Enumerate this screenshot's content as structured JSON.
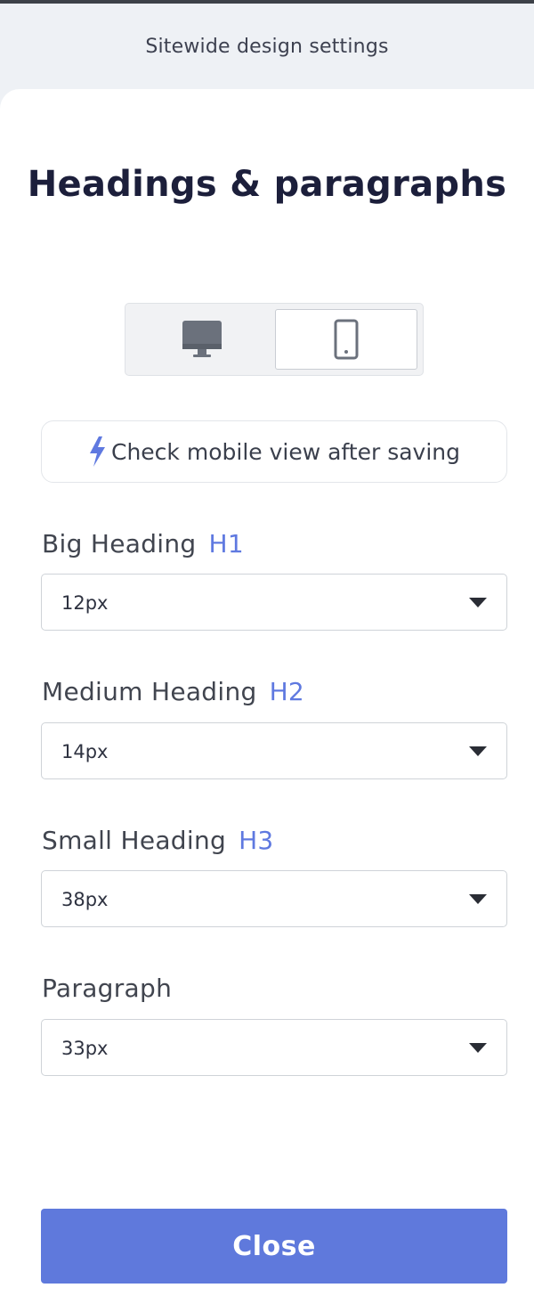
{
  "header": {
    "title": "Sitewide design settings"
  },
  "panel": {
    "title": "Headings & paragraphs",
    "device_toggle": {
      "options": [
        "desktop",
        "mobile"
      ],
      "selected": "mobile"
    },
    "notice": {
      "icon": "lightning-icon",
      "text": "Check mobile view after saving"
    },
    "fields": [
      {
        "label": "Big Heading",
        "tag": "H1",
        "value": "12px"
      },
      {
        "label": "Medium Heading",
        "tag": "H2",
        "value": "14px"
      },
      {
        "label": "Small Heading",
        "tag": "H3",
        "value": "38px"
      },
      {
        "label": "Paragraph",
        "tag": "",
        "value": "33px"
      }
    ],
    "close_label": "Close"
  },
  "colors": {
    "accent": "#5f79dc",
    "title": "#1c1f3b",
    "tag": "#5f79e0"
  }
}
